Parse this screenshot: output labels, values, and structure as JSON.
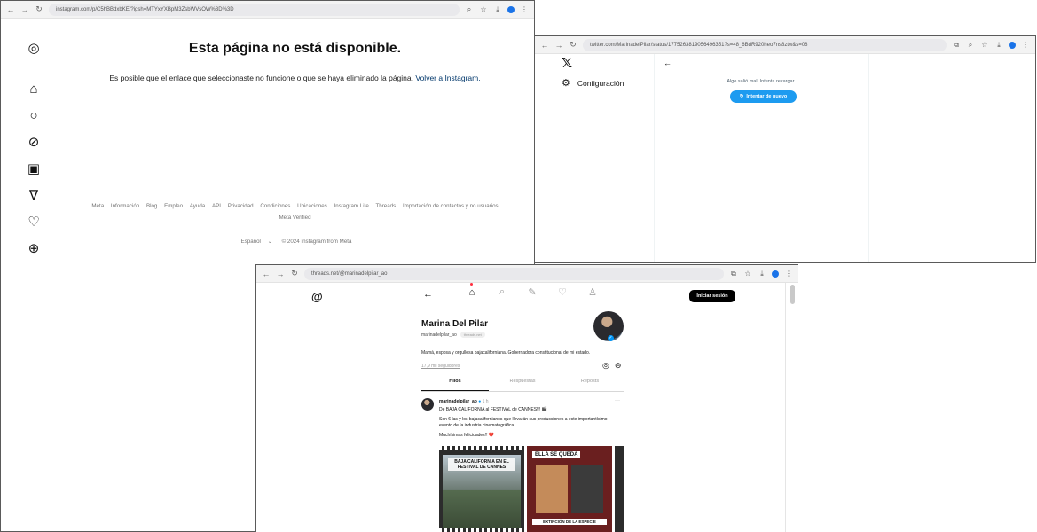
{
  "instagram": {
    "url": "instagram.com/p/C5hBBdxbKE/?igsh=MTYxYXBpM3ZsbWVsOW%3D%3D",
    "title": "Esta página no está disponible.",
    "message": "Es posible que el enlace que seleccionaste no funcione o que se haya eliminado la página.",
    "link": "Volver a Instagram.",
    "footer_links": [
      "Meta",
      "Información",
      "Blog",
      "Empleo",
      "Ayuda",
      "API",
      "Privacidad",
      "Condiciones",
      "Ubicaciones",
      "Instagram Lite",
      "Threads",
      "Importación de contactos y no usuarios",
      "Meta Verified"
    ],
    "language": "Español",
    "copyright": "© 2024 Instagram from Meta"
  },
  "twitter": {
    "url": "twitter.com/MarinadelPilar/status/1775263819056496351?s=48_6BdR920heo7ns8ztw&s=08",
    "settings_label": "Configuración",
    "error": "Algo salió mal. Intenta recargar.",
    "retry_label": "Intentar de nuevo"
  },
  "threads": {
    "url": "threads.net/@marinadelpilar_ao",
    "login_label": "Iniciar sesión",
    "name": "Marina Del Pilar",
    "handle": "marinadelpilar_ao",
    "handle_pill": "threads.net",
    "bio": "Mamá, esposa y orgullosa bajacaliforniana. Gobernadora constitucional de mi estado.",
    "followers": "17,9 mil seguidores",
    "tabs": [
      "Hilos",
      "Respuestas",
      "Reposts"
    ],
    "post": {
      "user": "marinadelpilar_ao",
      "time": "1 h",
      "line1": "De BAJA CALIFORNIA al FESTIVAL de CANNES!!! 🎬",
      "line2": "Son 6 las y los bajacalifornianos que llevarán sus producciones a este importantísimo evento de la industria cinematográfica.",
      "line3": "Muchísimas felicidades!! ❤️",
      "img1_caption": "BAJA CALIFORNIA EN EL FESTIVAL DE CANNES",
      "img2_caption_top": "ELLA SE QUEDA",
      "img2_caption_bottom": "EXTINCIÓN DE LA ESPECIE"
    }
  }
}
